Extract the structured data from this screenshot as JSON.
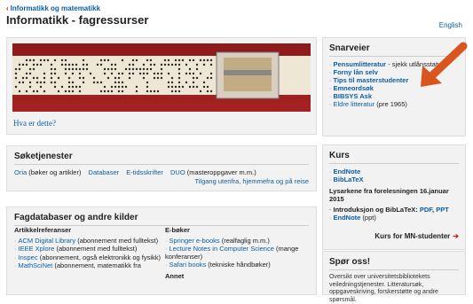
{
  "breadcrumb": "Informatikk og matematikk",
  "page_title": "Informatikk - fagressurser",
  "language_link": "English",
  "hero": {
    "link": "Hva er dette?"
  },
  "snarveier": {
    "title": "Snarveier",
    "items": [
      {
        "link": "Pensumlitteratur",
        "rest": " - sjekk utlånsstatus"
      },
      {
        "link": "Forny lån selv",
        "rest": ""
      },
      {
        "link": "Tips til masterstudenter",
        "rest": ""
      },
      {
        "link": "Emneordsøk",
        "rest": ""
      },
      {
        "link": "BIBSYS Ask",
        "rest": ""
      },
      {
        "link": "Eldre litteratur",
        "rest": " (pre 1965)"
      }
    ]
  },
  "soketjenester": {
    "title": "Søketjenester",
    "oria": "Oria",
    "oria_note": " (bøker og artikler)",
    "database": "Databaser",
    "etids": "E-tidsskrifter",
    "duo": "DUO",
    "duo_note": " (masteroppgaver m.m.)",
    "access": "Tilgang utenfra, hjemmefra og på reise"
  },
  "fagdatabaser": {
    "title": "Fagdatabaser og andre kilder",
    "left_heading": "Artikkelreferanser",
    "left_items": [
      {
        "link": "ACM Digital Library",
        "rest": " (abonnement med fulltekst)"
      },
      {
        "link": "IEEE Xplore",
        "rest": " (abonnement med fulltekst)"
      },
      {
        "link": "Inspec",
        "rest": " (abonnement, også elektronikk og fysikk)"
      },
      {
        "link": "MathSciNet",
        "rest": " (abonnement, matematikk fra"
      }
    ],
    "right_heading": "E-bøker",
    "right_items": [
      {
        "link": "Springer e-books",
        "rest": " (realfaglig m.m.)"
      },
      {
        "link": "Lecture Notes in Computer Science",
        "rest": " (mange konferanser)"
      },
      {
        "link": "Safari books",
        "rest": " (tekniske håndbøker)"
      }
    ],
    "right_heading2": "Annet"
  },
  "kurs": {
    "title": "Kurs",
    "items": [
      "EndNote",
      "BibLaTeX"
    ],
    "note": "Lysarkene fra forelesningen 16.januar 2015",
    "intro_label": "Introduksjon og BibLaTeX: ",
    "pdf": "PDF",
    "sep": ", ",
    "ppt": "PPT",
    "endnote2": "EndNote",
    "endnote2_rest": " (ppt)",
    "mn": "Kurs for MN-studenter",
    "mn_arrow": "➔"
  },
  "spor": {
    "title": "Spør oss!",
    "text": "Oversikt over universitetsbibliotekets veiledningstjenester. Litteratursøk, oppgaveskriving, forskerstøtte og andre spørsmål."
  },
  "colors": {
    "link": "#0b5fa5",
    "panel": "#f2f2f2",
    "accent_arrow": "#d9541e"
  }
}
